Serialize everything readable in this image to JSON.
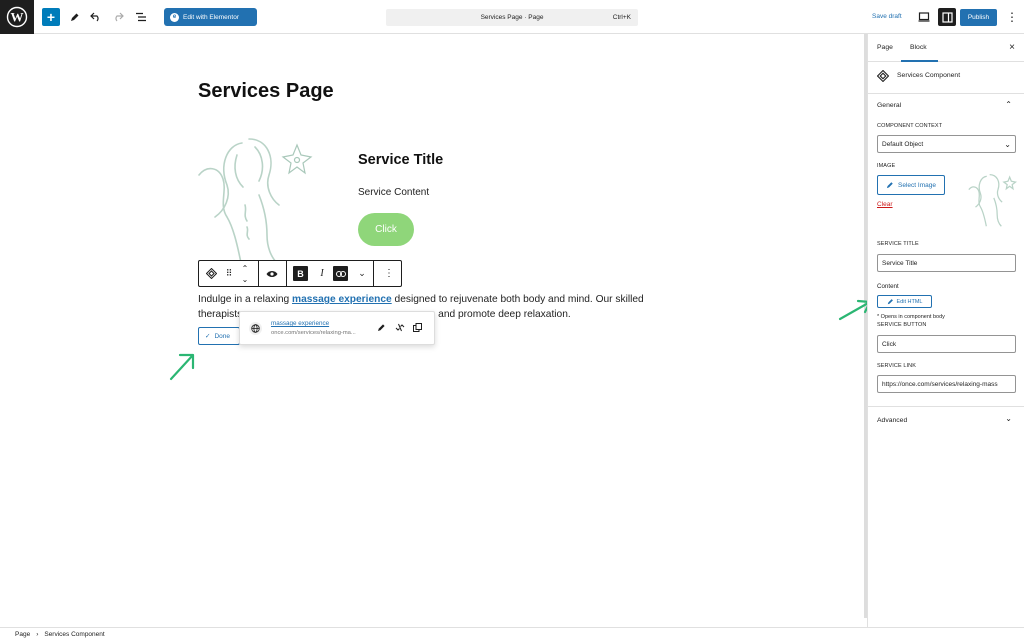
{
  "topbar": {
    "edit_with_elementor": "Edit with Elementor",
    "command_title": "Services Page · Page",
    "command_shortcut": "Ctrl+K",
    "save_draft": "Save draft",
    "publish": "Publish"
  },
  "canvas": {
    "page_title": "Services Page",
    "service_title": "Service Title",
    "service_content": "Service Content",
    "click_label": "Click",
    "paragraph_before": "Indulge in a relaxing ",
    "paragraph_link": "massage experience",
    "paragraph_after": " designed to rejuvenate both body and mind. Our skilled",
    "paragraph_line2a": "therapists",
    "paragraph_line2b": "and promote deep relaxation.",
    "done_label": "Done",
    "link_popover": {
      "title": "massage experience",
      "url": "once.com/services/relaxing-ma..."
    }
  },
  "sidebar": {
    "tab_page": "Page",
    "tab_block": "Block",
    "block_name": "Services Component",
    "general": "General",
    "component_context_label": "COMPONENT CONTEXT",
    "component_context_value": "Default Object",
    "image_label": "IMAGE",
    "select_image": "Select Image",
    "clear": "Clear",
    "service_title_label": "SERVICE TITLE",
    "service_title_value": "Service Title",
    "content_label": "Content",
    "edit_html": "Edit HTML",
    "content_help": "* Opens in component body",
    "service_button_label": "SERVICE BUTTON",
    "service_button_value": "Click",
    "service_link_label": "SERVICE LINK",
    "service_link_value": "https://once.com/services/relaxing-mass",
    "advanced": "Advanced"
  },
  "breadcrumb": {
    "root": "Page",
    "current": "Services Component"
  },
  "colors": {
    "accent": "#2271b1",
    "button_green": "#8fd67a",
    "arrow_green": "#2bb673",
    "danger": "#cc1818"
  }
}
